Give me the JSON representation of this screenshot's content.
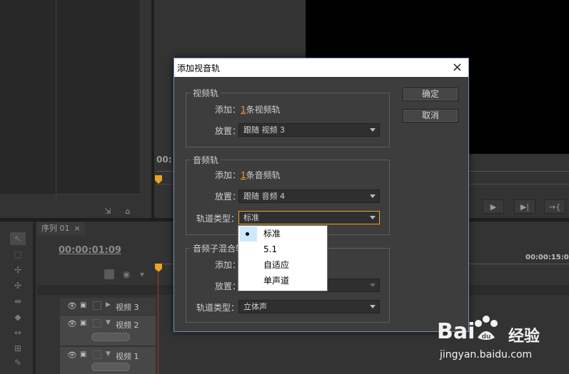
{
  "background": {
    "timecode_top": "00:",
    "sequence_tab": {
      "label": "序列 01",
      "close": "×"
    },
    "sequence_time": "00:00:01:09",
    "ruler_time": "00:00:15:00",
    "tracks": [
      {
        "label": "视频 3"
      },
      {
        "label": "视频 2"
      },
      {
        "label": "视频 1"
      }
    ],
    "transport_buttons": [
      "▶",
      "▶|",
      "→{"
    ]
  },
  "dialog": {
    "title": "添加视音轨",
    "close": "×",
    "ok_label": "确定",
    "cancel_label": "取消",
    "video": {
      "title": "视频轨",
      "add_label": "添加：",
      "count": "1",
      "unit": "条视频轨",
      "place_label": "放置：",
      "place_value": "跟随 视频 3"
    },
    "audio": {
      "title": "音频轨",
      "add_label": "添加：",
      "count": "1",
      "unit": "条音频轨",
      "place_label": "放置：",
      "place_value": "跟随 音频 4",
      "type_label": "轨道类型：",
      "type_value": "标准"
    },
    "submix": {
      "title": "音频子混合轨",
      "add_label": "添加：",
      "place_label": "放置：",
      "type_label": "轨道类型：",
      "type_value": "立体声"
    },
    "type_options": [
      "标准",
      "5.1",
      "自适应",
      "单声道"
    ],
    "type_selected_index": 0
  },
  "watermark": {
    "brand": "Bai",
    "brand_tail": "du",
    "zh": "经验",
    "url": "jingyan.baidu.com"
  }
}
